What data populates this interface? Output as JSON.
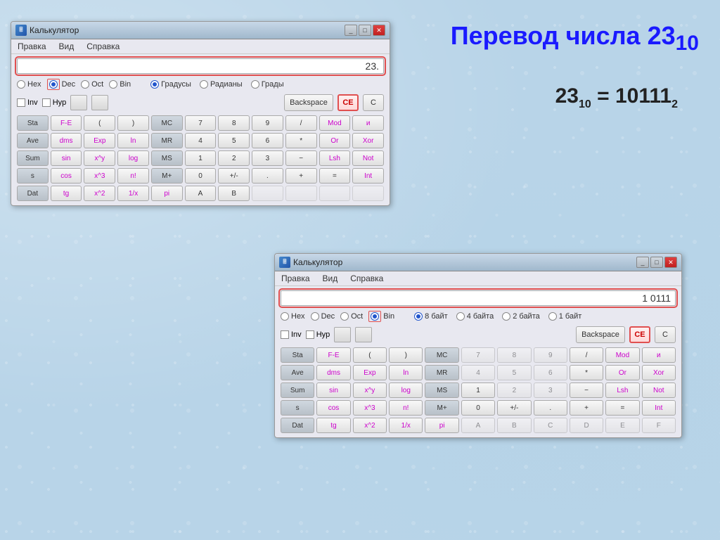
{
  "page": {
    "title": "Перевод числа 23₁₀",
    "title_main": "Перевод числа 23",
    "title_sub": "10",
    "formula": "23",
    "formula_sub1": "10",
    "formula_eq": " = 10111",
    "formula_sub2": "2"
  },
  "calc1": {
    "title": "Калькулятор",
    "menu": [
      "Правка",
      "Вид",
      "Справка"
    ],
    "display": "23.",
    "radios_left": [
      "Hex",
      "Dec",
      "Oct",
      "Bin"
    ],
    "radios_left_selected": "Dec",
    "radios_right": [
      "Градусы",
      "Радианы",
      "Грады"
    ],
    "radios_right_selected": "Градусы",
    "checkboxes": [
      "Inv",
      "Hyp"
    ],
    "top_buttons": [
      "Backspace",
      "CE",
      "C"
    ],
    "rows": [
      [
        "Sta",
        "F-E",
        "(",
        ")",
        "MC",
        "7",
        "8",
        "9",
        "/",
        "Mod",
        "и"
      ],
      [
        "Ave",
        "dms",
        "Exp",
        "ln",
        "MR",
        "4",
        "5",
        "6",
        "*",
        "Or",
        "Xor"
      ],
      [
        "Sum",
        "sin",
        "x^y",
        "log",
        "MS",
        "1",
        "2",
        "3",
        "−",
        "Lsh",
        "Not"
      ],
      [
        "s",
        "cos",
        "x^3",
        "n!",
        "M+",
        "0",
        "+/-",
        ".",
        "+",
        "=",
        "Int"
      ],
      [
        "Dat",
        "tg",
        "x^2",
        "1/x",
        "pi",
        "A",
        "B"
      ]
    ]
  },
  "calc2": {
    "title": "Калькулятор",
    "menu": [
      "Правка",
      "Вид",
      "Справка"
    ],
    "display": "1 0111",
    "radios_left": [
      "Hex",
      "Dec",
      "Oct",
      "Bin"
    ],
    "radios_left_selected": "Bin",
    "radios_right": [
      "8 байт",
      "4 байта",
      "2 байта",
      "1 байт"
    ],
    "radios_right_selected": "8 байт",
    "checkboxes": [
      "Inv",
      "Hyp"
    ],
    "top_buttons": [
      "Backspace",
      "CE",
      "C"
    ],
    "rows": [
      [
        "Sta",
        "F-E",
        "(",
        ")",
        "MC",
        "7",
        "8",
        "9",
        "/",
        "Mod",
        "и"
      ],
      [
        "Ave",
        "dms",
        "Exp",
        "ln",
        "MR",
        "4",
        "5",
        "6",
        "*",
        "Or",
        "Xor"
      ],
      [
        "Sum",
        "sin",
        "x^y",
        "log",
        "MS",
        "1",
        "2",
        "3",
        "−",
        "Lsh",
        "Not"
      ],
      [
        "s",
        "cos",
        "x^3",
        "n!",
        "M+",
        "0",
        "+/-",
        ".",
        "+",
        "=",
        "Int"
      ],
      [
        "Dat",
        "tg",
        "x^2",
        "1/x",
        "pi",
        "A",
        "B",
        "C",
        "D",
        "E",
        "F"
      ]
    ]
  },
  "colors": {
    "accent": "#e05050",
    "blue_text": "#cc00cc",
    "title_color": "#1a1aff"
  }
}
